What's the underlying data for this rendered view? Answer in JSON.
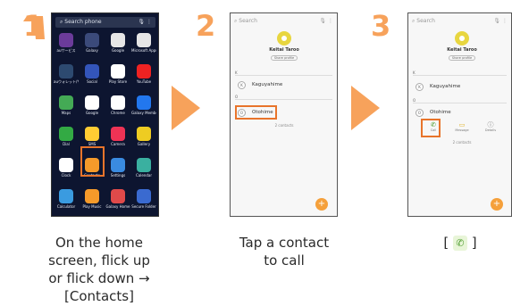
{
  "steps": [
    {
      "number": "1",
      "caption": [
        "On the home",
        "screen, flick up",
        "or flick down →",
        "[Contacts]"
      ]
    },
    {
      "number": "2",
      "caption": [
        "Tap a contact",
        "to call"
      ]
    },
    {
      "number": "3",
      "caption_prefix": "[",
      "caption_suffix": "]",
      "icon": "phone-call-icon"
    }
  ],
  "colors": {
    "accent": "#f7a25b",
    "highlight": "#e8742b",
    "fab": "#f5a03b"
  },
  "phone1": {
    "search_placeholder": "Search phone",
    "apps": [
      {
        "label": "auサービス",
        "icon": "apps-folder-icon",
        "color": "#6b3b9a"
      },
      {
        "label": "Galaxy",
        "icon": "galaxy-folder-icon",
        "color": "#3b4a7a"
      },
      {
        "label": "Google",
        "icon": "google-folder-icon",
        "color": "#e6e6e6"
      },
      {
        "label": "Microsoft Apps",
        "icon": "microsoft-folder-icon",
        "color": "#e6e6e6"
      },
      {
        "label": "auウォレット/サービス",
        "icon": "au-folder-icon",
        "color": "#2d4a70"
      },
      {
        "label": "Social",
        "icon": "social-folder-icon",
        "color": "#3355bb"
      },
      {
        "label": "Play Store",
        "icon": "play-store-icon",
        "color": "#ffffff"
      },
      {
        "label": "YouTube",
        "icon": "youtube-icon",
        "color": "#ee2222"
      },
      {
        "label": "Maps",
        "icon": "maps-icon",
        "color": "#44aa55"
      },
      {
        "label": "Google",
        "icon": "google-icon",
        "color": "#ffffff"
      },
      {
        "label": "Chrome",
        "icon": "chrome-icon",
        "color": "#ffffff"
      },
      {
        "label": "Galaxy Members",
        "icon": "members-icon",
        "color": "#2277ee"
      },
      {
        "label": "Dial",
        "icon": "dial-icon",
        "color": "#33aa44"
      },
      {
        "label": "SMS",
        "icon": "sms-icon",
        "color": "#ffcc33"
      },
      {
        "label": "Camera",
        "icon": "camera-icon",
        "color": "#ee3355"
      },
      {
        "label": "Gallery",
        "icon": "gallery-icon",
        "color": "#eecc22"
      },
      {
        "label": "Clock",
        "icon": "clock-icon",
        "color": "#ffffff"
      },
      {
        "label": "Contacts",
        "icon": "contacts-icon",
        "color": "#f59a2a"
      },
      {
        "label": "Settings",
        "icon": "settings-icon",
        "color": "#3a8be0"
      },
      {
        "label": "Calendar",
        "icon": "calendar-icon",
        "color": "#3ab0a0"
      },
      {
        "label": "Calculator",
        "icon": "calculator-icon",
        "color": "#3a9be0"
      },
      {
        "label": "Play Music",
        "icon": "play-music-icon",
        "color": "#f59a2a"
      },
      {
        "label": "Galaxy Home",
        "icon": "galaxy-home-icon",
        "color": "#e04a4a"
      },
      {
        "label": "Secure Folder",
        "icon": "secure-folder-icon",
        "color": "#3a6ad0"
      }
    ]
  },
  "contacts_screen": {
    "search_placeholder": "Search",
    "me_name": "Keitai Taroo",
    "share_profile": "Share profile",
    "section_k": "K",
    "section_o": "O",
    "contacts": [
      {
        "initial": "K",
        "name": "Kaguyahime"
      },
      {
        "initial": "O",
        "name": "Otohime"
      }
    ],
    "count": "2 contacts",
    "fab_label": "+"
  },
  "detail_screen": {
    "actions": [
      {
        "label": "Call",
        "icon": "phone-icon"
      },
      {
        "label": "Message",
        "icon": "message-icon"
      },
      {
        "label": "Details",
        "icon": "info-icon"
      }
    ]
  }
}
